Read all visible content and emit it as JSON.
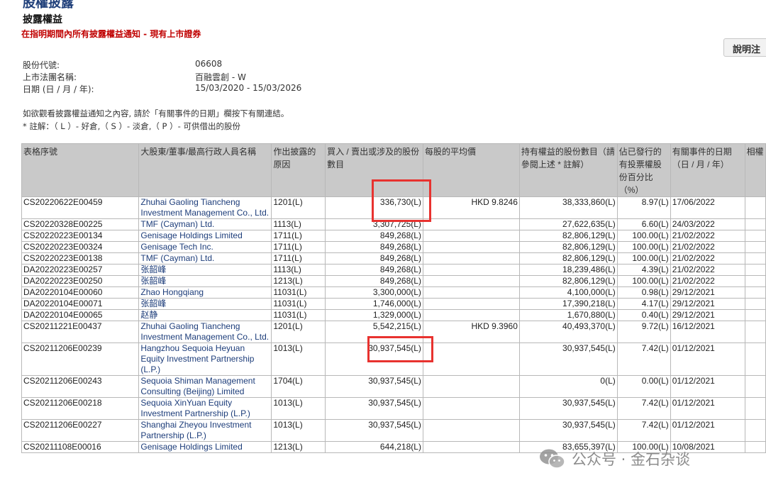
{
  "page": {
    "heading": "股權披露",
    "section_title": "披露權益",
    "subtitle": "在指明期間內所有披露權益通知 - 現有上市證券",
    "help_button": "說明注"
  },
  "info": [
    {
      "label": "股份代號:",
      "value": "06608"
    },
    {
      "label": "上市法團名稱:",
      "value": "百融雲創 - W"
    },
    {
      "label": "日期 (日 / 月 / 年):",
      "value": "15/03/2020 - 15/03/2026"
    }
  ],
  "notes": [
    "如欲觀看披露權益通知之內容, 請於「有關事件的日期」欄按下有關連結。",
    " * 註解：（ L ）- 好倉,（ S ）- 淡倉,（ P ）- 可供借出的股份"
  ],
  "table": {
    "headers": [
      "表格序號",
      "大股東/董事/最高行政人員名稱",
      "作出披露的原因",
      "買入 / 賣出或涉及的股份數目",
      "每股的平均價",
      "持有權益的股份數目（請參閱上述 * 註解）",
      "佔已發行的有投票權股份百分比（%）",
      "有關事件的日期（日 / 月 / 年）",
      "相權"
    ],
    "rows": [
      {
        "serial": "CS20220622E00459",
        "name": "Zhuhai Gaoling Tiancheng Investment Management Co., Ltd.",
        "reason": "1201(L)",
        "shares": "336,730(L)",
        "price": "HKD 9.8246",
        "held": "38,333,860(L)",
        "pct": "8.97(L)",
        "date": "17/06/2022"
      },
      {
        "serial": "CS20220328E00225",
        "name": "TMF (Cayman) Ltd.",
        "reason": "1113(L)",
        "shares": "3,307,725(L)",
        "price": "",
        "held": "27,622,635(L)",
        "pct": "6.60(L)",
        "date": "24/03/2022"
      },
      {
        "serial": "CS20220223E00134",
        "name": "Genisage Holdings Limited",
        "reason": "1711(L)",
        "shares": "849,268(L)",
        "price": "",
        "held": "82,806,129(L)",
        "pct": "100.00(L)",
        "date": "21/02/2022"
      },
      {
        "serial": "CS20220223E00324",
        "name": "Genisage Tech Inc.",
        "reason": "1711(L)",
        "shares": "849,268(L)",
        "price": "",
        "held": "82,806,129(L)",
        "pct": "100.00(L)",
        "date": "21/02/2022"
      },
      {
        "serial": "CS20220223E00138",
        "name": "TMF (Cayman) Ltd.",
        "reason": "1711(L)",
        "shares": "849,268(L)",
        "price": "",
        "held": "82,806,129(L)",
        "pct": "100.00(L)",
        "date": "21/02/2022"
      },
      {
        "serial": "DA20220223E00257",
        "name": "张韶峰",
        "reason": "1113(L)",
        "shares": "849,268(L)",
        "price": "",
        "held": "18,239,486(L)",
        "pct": "4.39(L)",
        "date": "21/02/2022"
      },
      {
        "serial": "DA20220223E00250",
        "name": "张韶峰",
        "reason": "1213(L)",
        "shares": "849,268(L)",
        "price": "",
        "held": "82,806,129(L)",
        "pct": "100.00(L)",
        "date": "21/02/2022"
      },
      {
        "serial": "DA20220104E00060",
        "name": "Zhao Hongqiang",
        "reason": "11031(L)",
        "shares": "3,300,000(L)",
        "price": "",
        "held": "4,100,000(L)",
        "pct": "0.98(L)",
        "date": "29/12/2021"
      },
      {
        "serial": "DA20220104E00071",
        "name": "张韶峰",
        "reason": "11031(L)",
        "shares": "1,746,000(L)",
        "price": "",
        "held": "17,390,218(L)",
        "pct": "4.17(L)",
        "date": "29/12/2021"
      },
      {
        "serial": "DA20220104E00065",
        "name": "赵静",
        "reason": "11031(L)",
        "shares": "1,329,000(L)",
        "price": "",
        "held": "1,670,880(L)",
        "pct": "0.40(L)",
        "date": "29/12/2021"
      },
      {
        "serial": "CS20211221E00437",
        "name": "Zhuhai Gaoling Tiancheng Investment Management Co., Ltd.",
        "reason": "1201(L)",
        "shares": "5,542,215(L)",
        "price": "HKD 9.3960",
        "held": "40,493,370(L)",
        "pct": "9.72(L)",
        "date": "16/12/2021"
      },
      {
        "serial": "CS20211206E00239",
        "name": "Hangzhou Sequoia Heyuan Equity Investment Partnership (L.P.)",
        "reason": "1013(L)",
        "shares": "30,937,545(L)",
        "price": "",
        "held": "30,937,545(L)",
        "pct": "7.42(L)",
        "date": "01/12/2021"
      },
      {
        "serial": "CS20211206E00243",
        "name": "Sequoia Shiman Management Consulting (Beijing) Limited",
        "reason": "1704(L)",
        "shares": "30,937,545(L)",
        "price": "",
        "held": "0(L)",
        "pct": "0.00(L)",
        "date": "01/12/2021"
      },
      {
        "serial": "CS20211206E00218",
        "name": "Sequoia XinYuan Equity Investment Partnership (L.P.)",
        "reason": "1013(L)",
        "shares": "30,937,545(L)",
        "price": "",
        "held": "30,937,545(L)",
        "pct": "7.42(L)",
        "date": "01/12/2021"
      },
      {
        "serial": "CS20211206E00227",
        "name": "Shanghai Zheyou Investment Partnership (L.P.)",
        "reason": "1013(L)",
        "shares": "30,937,545(L)",
        "price": "",
        "held": "30,937,545(L)",
        "pct": "7.42(L)",
        "date": "01/12/2021"
      },
      {
        "serial": "CS20211108E00016",
        "name": "Genisage Holdings Limited",
        "reason": "1213(L)",
        "shares": "644,218(L)",
        "price": "",
        "held": "83,655,397(L)",
        "pct": "100.00(L)",
        "date": "10/08/2021"
      }
    ]
  },
  "watermark": {
    "text": "公众号 · 金石杂谈",
    "icon": "wechat-icon"
  },
  "colors": {
    "highlight": "#e8322f",
    "header_bg": "#c9c9c9",
    "link": "#1d3d7a",
    "subtitle": "#c00000"
  }
}
